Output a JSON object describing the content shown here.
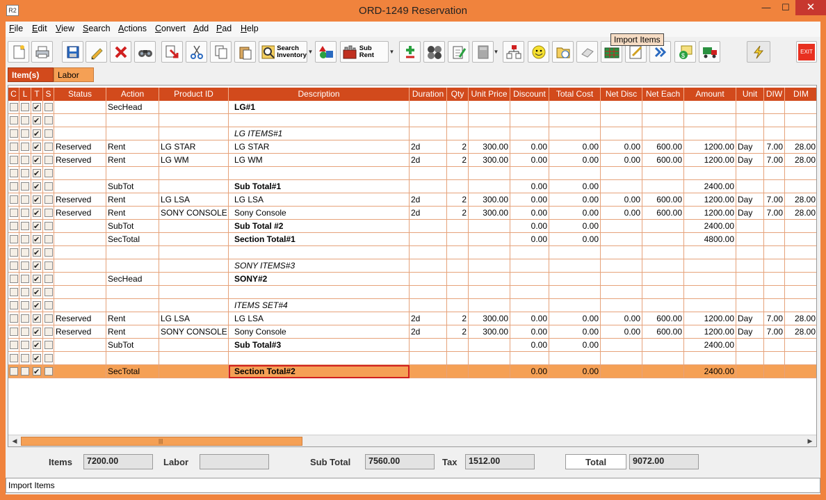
{
  "window": {
    "title": "ORD-1249 Reservation",
    "app_icon_text": "R2"
  },
  "menu": [
    {
      "label": "File",
      "ul": "F",
      "rest": "ile"
    },
    {
      "label": "Edit",
      "ul": "E",
      "rest": "dit"
    },
    {
      "label": "View",
      "ul": "V",
      "rest": "iew"
    },
    {
      "label": "Search",
      "ul": "S",
      "rest": "earch"
    },
    {
      "label": "Actions",
      "ul": "A",
      "rest": "ctions"
    },
    {
      "label": "Convert",
      "ul": "C",
      "rest": "onvert"
    },
    {
      "label": "Add",
      "ul": "A",
      "rest": "dd"
    },
    {
      "label": "Pad",
      "ul": "P",
      "rest": "ad"
    },
    {
      "label": "Help",
      "ul": "H",
      "rest": "elp"
    }
  ],
  "toolbar": {
    "search_inventory_line1": "Search",
    "search_inventory_line2": "Inventory",
    "sub_rent_label": "Sub Rent",
    "exit_label": "EXIT",
    "tooltip": "Import Items",
    "icons": [
      "new-icon",
      "print-icon",
      "save-icon",
      "edit-icon",
      "delete-icon",
      "binoculars-icon",
      "import-red-icon",
      "cut-icon",
      "copy-icon",
      "paste-icon",
      "search-inventory-icon",
      "shapes-icon",
      "sub-rent-icon",
      "add-subtract-icon",
      "balls-icon",
      "notepad-icon",
      "calculator-icon",
      "hierarchy-icon",
      "smiley-icon",
      "folder-clock-icon",
      "eraser-icon",
      "import-items-icon",
      "pencil-chart-icon",
      "arrows-icon",
      "money-icon",
      "truck-icon",
      "flash-icon",
      "exit-icon"
    ]
  },
  "tabs": {
    "items": "Item(s)",
    "labor": "Labor"
  },
  "columns": [
    "C",
    "L",
    "T",
    "S",
    "Status",
    "Action",
    "Product ID",
    "Description",
    "Duration",
    "Qty",
    "Unit Price",
    "Discount",
    "Total Cost",
    "Net Disc",
    "Net Each",
    "Amount",
    "Unit",
    "DIW",
    "DIM"
  ],
  "rows": [
    {
      "t": true,
      "status": "",
      "action": "SecHead",
      "pid": "",
      "desc": "LG#1",
      "style": "bold",
      "dur": "",
      "qty": "",
      "up": "",
      "disc": "",
      "tc": "",
      "nd": "",
      "ne": "",
      "amt": "",
      "unit": "",
      "diw": "",
      "dim": ""
    },
    {
      "t": true,
      "status": "",
      "action": "",
      "pid": "",
      "desc": "",
      "style": "",
      "dur": "",
      "qty": "",
      "up": "",
      "disc": "",
      "tc": "",
      "nd": "",
      "ne": "",
      "amt": "",
      "unit": "",
      "diw": "",
      "dim": ""
    },
    {
      "t": true,
      "status": "",
      "action": "",
      "pid": "",
      "desc": "LG ITEMS#1",
      "style": "ital",
      "dur": "",
      "qty": "",
      "up": "",
      "disc": "",
      "tc": "",
      "nd": "",
      "ne": "",
      "amt": "",
      "unit": "",
      "diw": "",
      "dim": ""
    },
    {
      "t": true,
      "status": "Reserved",
      "action": "Rent",
      "pid": "LG STAR",
      "desc": "LG STAR",
      "style": "plain",
      "dur": "2d",
      "qty": "2",
      "up": "300.00",
      "disc": "0.00",
      "tc": "0.00",
      "nd": "0.00",
      "ne": "600.00",
      "amt": "1200.00",
      "unit": "Day",
      "diw": "7.00",
      "dim": "28.00"
    },
    {
      "t": true,
      "status": "Reserved",
      "action": "Rent",
      "pid": "LG WM",
      "desc": "LG WM",
      "style": "plain",
      "dur": "2d",
      "qty": "2",
      "up": "300.00",
      "disc": "0.00",
      "tc": "0.00",
      "nd": "0.00",
      "ne": "600.00",
      "amt": "1200.00",
      "unit": "Day",
      "diw": "7.00",
      "dim": "28.00"
    },
    {
      "t": true,
      "status": "",
      "action": "",
      "pid": "",
      "desc": "",
      "style": "",
      "dur": "",
      "qty": "",
      "up": "",
      "disc": "",
      "tc": "",
      "nd": "",
      "ne": "",
      "amt": "",
      "unit": "",
      "diw": "",
      "dim": ""
    },
    {
      "t": true,
      "status": "",
      "action": "SubTot",
      "pid": "",
      "desc": "Sub Total#1",
      "style": "bold",
      "dur": "",
      "qty": "",
      "up": "",
      "disc": "0.00",
      "tc": "0.00",
      "nd": "",
      "ne": "",
      "amt": "2400.00",
      "unit": "",
      "diw": "",
      "dim": ""
    },
    {
      "t": true,
      "status": "Reserved",
      "action": "Rent",
      "pid": "LG LSA",
      "desc": "LG LSA",
      "style": "plain",
      "dur": "2d",
      "qty": "2",
      "up": "300.00",
      "disc": "0.00",
      "tc": "0.00",
      "nd": "0.00",
      "ne": "600.00",
      "amt": "1200.00",
      "unit": "Day",
      "diw": "7.00",
      "dim": "28.00"
    },
    {
      "t": true,
      "status": "Reserved",
      "action": "Rent",
      "pid": "SONY CONSOLE",
      "desc": "Sony Console",
      "style": "plain",
      "dur": "2d",
      "qty": "2",
      "up": "300.00",
      "disc": "0.00",
      "tc": "0.00",
      "nd": "0.00",
      "ne": "600.00",
      "amt": "1200.00",
      "unit": "Day",
      "diw": "7.00",
      "dim": "28.00"
    },
    {
      "t": true,
      "status": "",
      "action": "SubTot",
      "pid": "",
      "desc": "Sub Total #2",
      "style": "bold",
      "dur": "",
      "qty": "",
      "up": "",
      "disc": "0.00",
      "tc": "0.00",
      "nd": "",
      "ne": "",
      "amt": "2400.00",
      "unit": "",
      "diw": "",
      "dim": ""
    },
    {
      "t": true,
      "status": "",
      "action": "SecTotal",
      "pid": "",
      "desc": "Section Total#1",
      "style": "bold",
      "dur": "",
      "qty": "",
      "up": "",
      "disc": "0.00",
      "tc": "0.00",
      "nd": "",
      "ne": "",
      "amt": "4800.00",
      "unit": "",
      "diw": "",
      "dim": ""
    },
    {
      "t": true,
      "status": "",
      "action": "",
      "pid": "",
      "desc": "",
      "style": "",
      "dur": "",
      "qty": "",
      "up": "",
      "disc": "",
      "tc": "",
      "nd": "",
      "ne": "",
      "amt": "",
      "unit": "",
      "diw": "",
      "dim": ""
    },
    {
      "t": true,
      "status": "",
      "action": "",
      "pid": "",
      "desc": "SONY ITEMS#3",
      "style": "ital",
      "dur": "",
      "qty": "",
      "up": "",
      "disc": "",
      "tc": "",
      "nd": "",
      "ne": "",
      "amt": "",
      "unit": "",
      "diw": "",
      "dim": ""
    },
    {
      "t": true,
      "status": "",
      "action": "SecHead",
      "pid": "",
      "desc": "SONY#2",
      "style": "bold",
      "dur": "",
      "qty": "",
      "up": "",
      "disc": "",
      "tc": "",
      "nd": "",
      "ne": "",
      "amt": "",
      "unit": "",
      "diw": "",
      "dim": ""
    },
    {
      "t": true,
      "status": "",
      "action": "",
      "pid": "",
      "desc": "",
      "style": "",
      "dur": "",
      "qty": "",
      "up": "",
      "disc": "",
      "tc": "",
      "nd": "",
      "ne": "",
      "amt": "",
      "unit": "",
      "diw": "",
      "dim": ""
    },
    {
      "t": true,
      "status": "",
      "action": "",
      "pid": "",
      "desc": "ITEMS SET#4",
      "style": "ital",
      "dur": "",
      "qty": "",
      "up": "",
      "disc": "",
      "tc": "",
      "nd": "",
      "ne": "",
      "amt": "",
      "unit": "",
      "diw": "",
      "dim": ""
    },
    {
      "t": true,
      "status": "Reserved",
      "action": "Rent",
      "pid": "LG LSA",
      "desc": "LG LSA",
      "style": "plain",
      "dur": "2d",
      "qty": "2",
      "up": "300.00",
      "disc": "0.00",
      "tc": "0.00",
      "nd": "0.00",
      "ne": "600.00",
      "amt": "1200.00",
      "unit": "Day",
      "diw": "7.00",
      "dim": "28.00"
    },
    {
      "t": true,
      "status": "Reserved",
      "action": "Rent",
      "pid": "SONY CONSOLE",
      "desc": "Sony Console",
      "style": "plain",
      "dur": "2d",
      "qty": "2",
      "up": "300.00",
      "disc": "0.00",
      "tc": "0.00",
      "nd": "0.00",
      "ne": "600.00",
      "amt": "1200.00",
      "unit": "Day",
      "diw": "7.00",
      "dim": "28.00"
    },
    {
      "t": true,
      "status": "",
      "action": "SubTot",
      "pid": "",
      "desc": "Sub Total#3",
      "style": "bold",
      "dur": "",
      "qty": "",
      "up": "",
      "disc": "0.00",
      "tc": "0.00",
      "nd": "",
      "ne": "",
      "amt": "2400.00",
      "unit": "",
      "diw": "",
      "dim": ""
    },
    {
      "t": true,
      "status": "",
      "action": "",
      "pid": "",
      "desc": "",
      "style": "",
      "dur": "",
      "qty": "",
      "up": "",
      "disc": "",
      "tc": "",
      "nd": "",
      "ne": "",
      "amt": "",
      "unit": "",
      "diw": "",
      "dim": ""
    },
    {
      "t": true,
      "selected": true,
      "status": "",
      "action": "SecTotal",
      "pid": "",
      "desc": "Section Total#2",
      "style": "bold",
      "dur": "",
      "qty": "",
      "up": "",
      "disc": "0.00",
      "tc": "0.00",
      "nd": "",
      "ne": "",
      "amt": "2400.00",
      "unit": "",
      "diw": "",
      "dim": ""
    }
  ],
  "totals": {
    "items_label": "Items",
    "items_value": "7200.00",
    "labor_label": "Labor",
    "labor_value": "",
    "subtotal_label": "Sub Total",
    "subtotal_value": "7560.00",
    "tax_label": "Tax",
    "tax_value": "1512.00",
    "total_label": "Total",
    "total_value": "9072.00"
  },
  "status_bar": "Import Items",
  "colors": {
    "accent": "#f0833d",
    "header": "#d24a1c",
    "selected_row": "#f5a055"
  }
}
